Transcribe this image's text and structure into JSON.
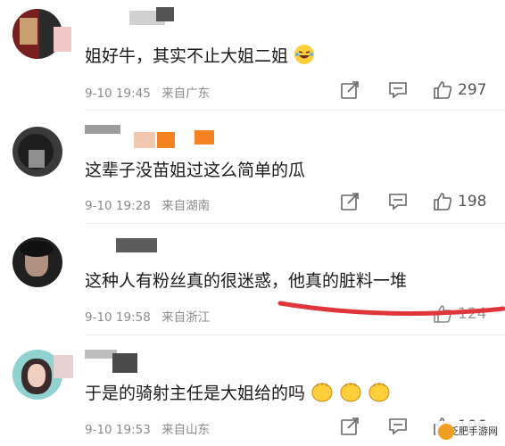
{
  "comments": [
    {
      "text": "姐好牛，其实不止大姐二姐",
      "time": "9-10 19:45",
      "location": "来自广东",
      "likes": "297",
      "emoji": "laughing-tears"
    },
    {
      "text": "这辈子没苗姐过这么简单的瓜",
      "time": "9-10 19:28",
      "location": "来自湖南",
      "likes": "198"
    },
    {
      "text": "这种人有粉丝真的很迷惑，他真的脏料一堆",
      "time": "9-10 19:58",
      "location": "来自浙江",
      "likes": "124"
    },
    {
      "text": "于是的骑射主任是大姐给的吗",
      "time": "9-10 19:53",
      "location": "来自山东",
      "likes": "106",
      "emoji": "clapping-hands x3"
    }
  ],
  "watermark": {
    "text": "泛肥手游网"
  },
  "colors": {
    "meta": "#8a8a8a",
    "red_stroke": "#e0353a",
    "watermark_logo": "#f0a020"
  }
}
